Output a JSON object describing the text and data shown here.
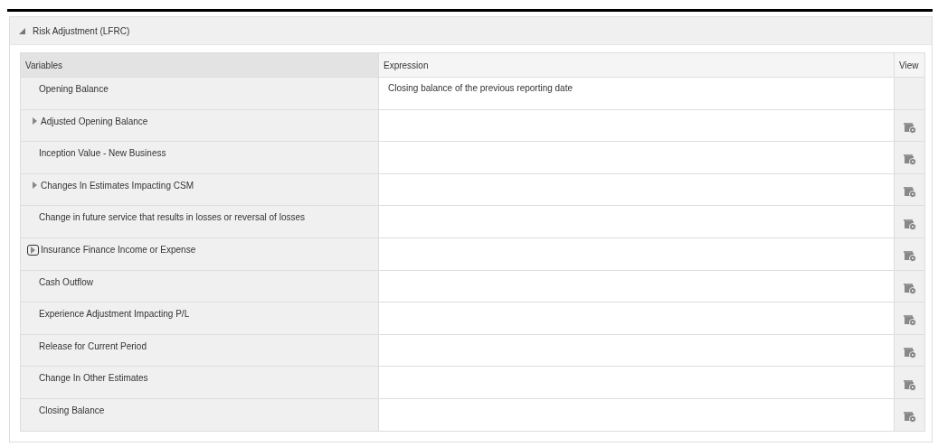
{
  "panel": {
    "title": "Risk Adjustment (LFRC)",
    "expanded": true
  },
  "table": {
    "columns": [
      "Variables",
      "Expression",
      "View"
    ],
    "rows": [
      {
        "variable": "Opening Balance",
        "expression": "Closing balance of the previous reporting date",
        "expandable": false,
        "focused": false,
        "view_icon": false
      },
      {
        "variable": "Adjusted Opening Balance",
        "expandable": true,
        "focused": false,
        "view_icon": true
      },
      {
        "variable": "Inception Value - New Business",
        "expandable": false,
        "focused": false,
        "view_icon": true
      },
      {
        "variable": "Changes In Estimates Impacting CSM",
        "expandable": true,
        "focused": false,
        "view_icon": true
      },
      {
        "variable": "Change in future service that results in losses or reversal of losses",
        "expandable": false,
        "focused": false,
        "view_icon": true
      },
      {
        "variable": "Insurance Finance Income or Expense",
        "expandable": true,
        "focused": true,
        "view_icon": true
      },
      {
        "variable": "Cash Outflow",
        "expandable": false,
        "focused": false,
        "view_icon": true
      },
      {
        "variable": "Experience Adjustment Impacting P/L",
        "expandable": false,
        "focused": false,
        "view_icon": true
      },
      {
        "variable": "Release for Current Period",
        "expandable": false,
        "focused": false,
        "view_icon": true
      },
      {
        "variable": "Change In Other Estimates",
        "expandable": false,
        "focused": false,
        "view_icon": true
      },
      {
        "variable": "Closing Balance",
        "expandable": false,
        "focused": false,
        "view_icon": true
      }
    ]
  }
}
